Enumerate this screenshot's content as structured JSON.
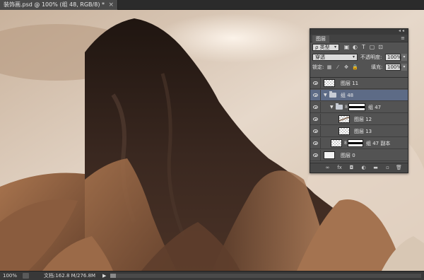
{
  "document": {
    "tab_title": "装饰画.psd @ 100% (组 48, RGB/8) *",
    "close_glyph": "×"
  },
  "statusbar": {
    "zoom": "100%",
    "doc_size": "文档:162.8 M/276.8M",
    "play_glyph": "▶"
  },
  "layers_panel": {
    "tab_label": "图层",
    "collapse_glyph": "◂◂",
    "close_glyph": "×",
    "menu_glyph": "≡",
    "filter": {
      "kind_label": "ρ 类型",
      "icons": [
        "image-filter-icon",
        "adjustment-filter-icon",
        "text-filter-icon",
        "shape-filter-icon",
        "smart-object-filter-icon"
      ],
      "icon_glyphs": [
        "▣",
        "◐",
        "T",
        "▢",
        "⊡"
      ]
    },
    "blend_mode": "穿透",
    "opacity_label": "不透明度:",
    "opacity_value": "100%",
    "lock_label": "锁定:",
    "lock_glyphs": [
      "▦",
      "⁄",
      "✥",
      "🔒"
    ],
    "fill_label": "填充:",
    "fill_value": "100%",
    "dropdown_glyph": "▾",
    "layers": [
      {
        "name": "图层 11",
        "type": "layer",
        "indent": 0,
        "selected": false,
        "thumb": "checker"
      },
      {
        "name": "组 48",
        "type": "group",
        "indent": 0,
        "selected": true,
        "expanded": true
      },
      {
        "name": "组 47",
        "type": "group-mask",
        "indent": 1,
        "selected": false,
        "expanded": true
      },
      {
        "name": "图层 12",
        "type": "layer",
        "indent": 2,
        "selected": false,
        "thumb": "brush"
      },
      {
        "name": "图层 13",
        "type": "layer",
        "indent": 2,
        "selected": false,
        "thumb": "checker"
      },
      {
        "name": "组 47 副本",
        "type": "layer-mask",
        "indent": 0,
        "selected": false,
        "thumb": "checker"
      },
      {
        "name": "图层 0",
        "type": "layer",
        "indent": 0,
        "selected": false,
        "thumb": "white"
      }
    ],
    "bottom_icons": [
      "link-icon",
      "fx-icon",
      "mask-icon",
      "adjustment-icon",
      "folder-icon",
      "new-layer-icon",
      "trash-icon"
    ],
    "bottom_glyphs": [
      "∞",
      "fx",
      "◘",
      "◐",
      "▬",
      "▫",
      "🗑"
    ]
  },
  "colors": {
    "panel_bg": "#535353",
    "selected_row": "#5d6b86",
    "canvas_sky": "#d9c6b2",
    "mountain_dark": "#2e2019",
    "mountain_light": "#a77552"
  }
}
